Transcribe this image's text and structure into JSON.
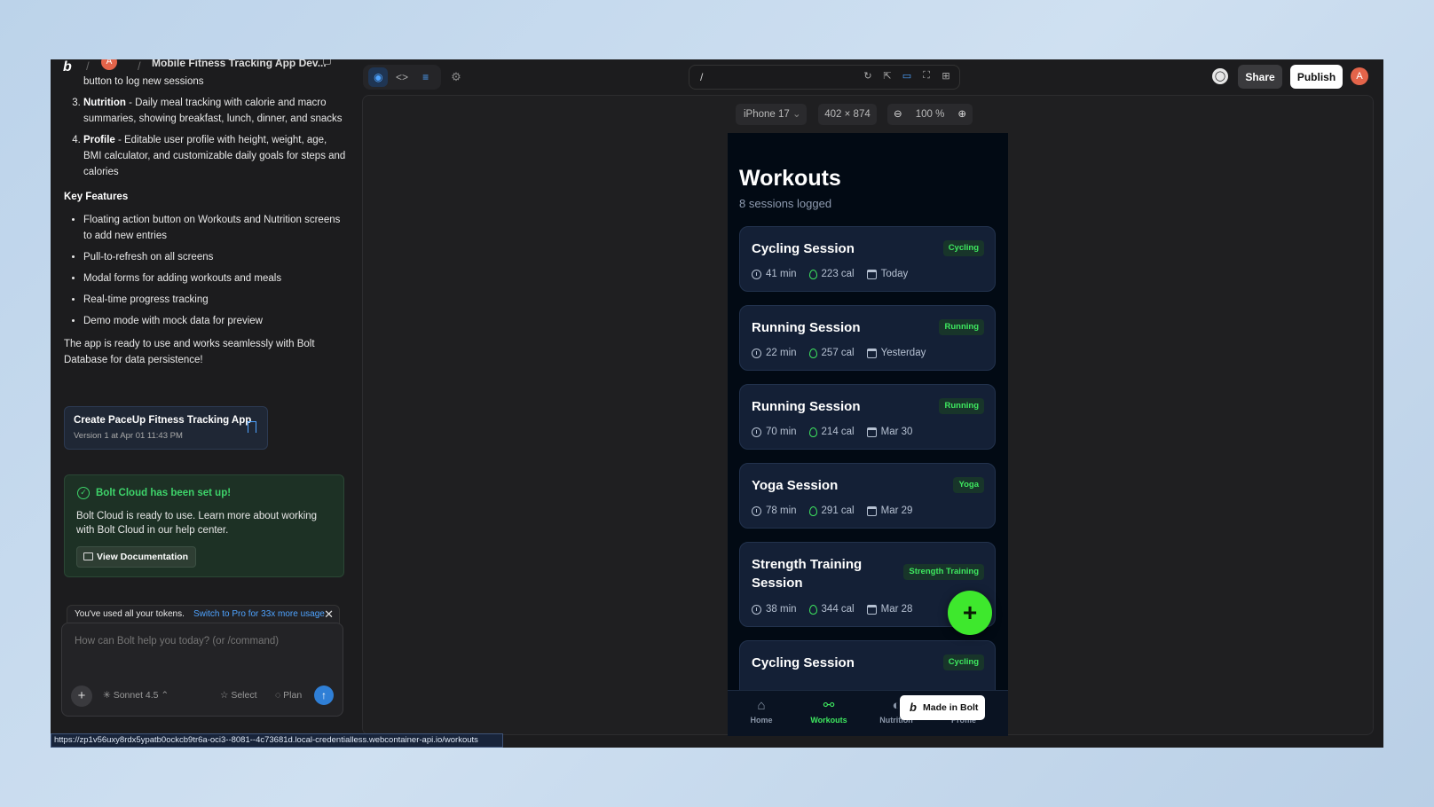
{
  "header": {
    "logo": "b",
    "avatar_initial": "A",
    "project_title": "Mobile Fitness Tracking App Dev...",
    "url_path": "/",
    "share_label": "Share",
    "publish_label": "Publish",
    "user_initial": "A"
  },
  "chat": {
    "line0": "button to log new sessions",
    "items": [
      {
        "num": "3.",
        "title": "Nutrition",
        "text": " - Daily meal tracking with calorie and macro summaries, showing breakfast, lunch, dinner, and snacks"
      },
      {
        "num": "4.",
        "title": "Profile",
        "text": " - Editable user profile with height, weight, age, BMI calculator, and customizable daily goals for steps and calories"
      }
    ],
    "key_features_heading": "Key Features",
    "features": [
      "Floating action button on Workouts and Nutrition screens to add new entries",
      "Pull-to-refresh on all screens",
      "Modal forms for adding workouts and meals",
      "Real-time progress tracking",
      "Demo mode with mock data for preview"
    ],
    "outro": "The app is ready to use and works seamlessly with Bolt Database for data persistence!",
    "version_card": {
      "title": "Create PaceUp Fitness Tracking App",
      "subtitle": "Version 1 at Apr 01 11:43 PM"
    },
    "cloud_card": {
      "title": "Bolt Cloud has been set up!",
      "body": "Bolt Cloud is ready to use. Learn more about working with Bolt Cloud in our help center.",
      "button": "View Documentation"
    },
    "tokens": {
      "text": "You've used all your tokens.",
      "link": "Switch to Pro for 33x more usage"
    },
    "prompt_placeholder": "How can Bolt help you today? (or /command)",
    "model": "Sonnet 4.5",
    "select_label": "Select",
    "plan_label": "Plan"
  },
  "status_url": "https://zp1v56uxy8rdx5ypatb0ockcb9tr6a-oci3--8081--4c73681d.local-credentialless.webcontainer-api.io/workouts",
  "preview": {
    "device": "iPhone 17",
    "dimensions": "402 × 874",
    "zoom": "100 %"
  },
  "app": {
    "title": "Workouts",
    "subtitle": "8 sessions logged",
    "cards": [
      {
        "title": "Cycling Session",
        "badge": "Cycling",
        "duration": "41 min",
        "calories": "223 cal",
        "date": "Today"
      },
      {
        "title": "Running Session",
        "badge": "Running",
        "duration": "22 min",
        "calories": "257 cal",
        "date": "Yesterday"
      },
      {
        "title": "Running Session",
        "badge": "Running",
        "duration": "70 min",
        "calories": "214 cal",
        "date": "Mar 30"
      },
      {
        "title": "Yoga Session",
        "badge": "Yoga",
        "duration": "78 min",
        "calories": "291 cal",
        "date": "Mar 29"
      },
      {
        "title": "Strength Training Session",
        "badge": "Strength Training",
        "duration": "38 min",
        "calories": "344 cal",
        "date": "Mar 28"
      },
      {
        "title": "Cycling Session",
        "badge": "Cycling",
        "duration": "",
        "calories": "",
        "date": ""
      }
    ],
    "tabs": [
      {
        "label": "Home",
        "icon": "home-icon"
      },
      {
        "label": "Workouts",
        "icon": "dumbbell-icon"
      },
      {
        "label": "Nutrition",
        "icon": "apple-icon"
      },
      {
        "label": "Profile",
        "icon": "user-icon"
      }
    ],
    "fab_label": "+",
    "made_in": "Made in Bolt",
    "accent_color": "#3ee85f"
  }
}
